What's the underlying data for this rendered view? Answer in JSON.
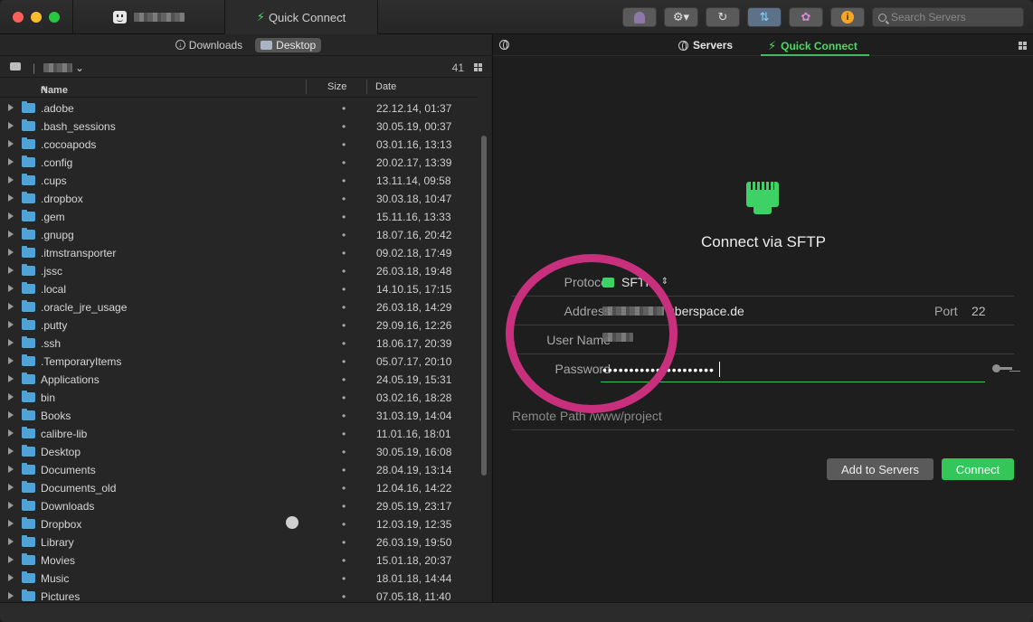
{
  "titlebar": {
    "tab_blurred_title": "",
    "tab_quick_connect": "Quick Connect",
    "search_placeholder": "Search Servers",
    "info_glyph": "i",
    "icons": [
      "ghost-icon",
      "gear-icon",
      "refresh-icon",
      "transfer-icon",
      "flower-icon",
      "info-icon",
      "search-icon"
    ]
  },
  "left_pane": {
    "locations": [
      "Downloads",
      "Desktop"
    ],
    "active_location": "Desktop",
    "path_separator": "|",
    "item_count": "41",
    "columns": {
      "name": "Name",
      "size": "Size",
      "date": "Date",
      "sort_arrow": "^"
    },
    "rows": [
      {
        "name": ".adobe",
        "size": "•",
        "date": "22.12.14, 01:37"
      },
      {
        "name": ".bash_sessions",
        "size": "•",
        "date": "30.05.19, 00:37"
      },
      {
        "name": ".cocoapods",
        "size": "•",
        "date": "03.01.16, 13:13"
      },
      {
        "name": ".config",
        "size": "•",
        "date": "20.02.17, 13:39"
      },
      {
        "name": ".cups",
        "size": "•",
        "date": "13.11.14, 09:58"
      },
      {
        "name": ".dropbox",
        "size": "•",
        "date": "30.03.18, 10:47"
      },
      {
        "name": ".gem",
        "size": "•",
        "date": "15.11.16, 13:33"
      },
      {
        "name": ".gnupg",
        "size": "•",
        "date": "18.07.16, 20:42"
      },
      {
        "name": ".itmstransporter",
        "size": "•",
        "date": "09.02.18, 17:49"
      },
      {
        "name": ".jssc",
        "size": "•",
        "date": "26.03.18, 19:48"
      },
      {
        "name": ".local",
        "size": "•",
        "date": "14.10.15, 17:15"
      },
      {
        "name": ".oracle_jre_usage",
        "size": "•",
        "date": "26.03.18, 14:29"
      },
      {
        "name": ".putty",
        "size": "•",
        "date": "29.09.16, 12:26"
      },
      {
        "name": ".ssh",
        "size": "•",
        "date": "18.06.17, 20:39"
      },
      {
        "name": ".TemporaryItems",
        "size": "•",
        "date": "05.07.17, 20:10"
      },
      {
        "name": "Applications",
        "size": "•",
        "date": "24.05.19, 15:31"
      },
      {
        "name": "bin",
        "size": "•",
        "date": "03.02.16, 18:28"
      },
      {
        "name": "Books",
        "size": "•",
        "date": "31.03.19, 14:04"
      },
      {
        "name": "calibre-lib",
        "size": "•",
        "date": "11.01.16, 18:01"
      },
      {
        "name": "Desktop",
        "size": "•",
        "date": "30.05.19, 16:08"
      },
      {
        "name": "Documents",
        "size": "•",
        "date": "28.04.19, 13:14"
      },
      {
        "name": "Documents_old",
        "size": "•",
        "date": "12.04.16, 14:22"
      },
      {
        "name": "Downloads",
        "size": "•",
        "date": "29.05.19, 23:17"
      },
      {
        "name": "Dropbox",
        "size": "•",
        "date": "12.03.19, 12:35"
      },
      {
        "name": "Library",
        "size": "•",
        "date": "26.03.19, 19:50"
      },
      {
        "name": "Movies",
        "size": "•",
        "date": "15.01.18, 20:37"
      },
      {
        "name": "Music",
        "size": "•",
        "date": "18.01.18, 14:44"
      },
      {
        "name": "Pictures",
        "size": "•",
        "date": "07.05.18, 11:40"
      }
    ]
  },
  "right_pane": {
    "tabs": {
      "servers": "Servers",
      "quick_connect": "Quick Connect"
    },
    "title": "Connect via SFTP",
    "form": {
      "protocol_label": "Protocol",
      "protocol_value": "SFTP",
      "address_label": "Address",
      "address_value": "uberspace.de",
      "port_label": "Port",
      "port_value": "22",
      "username_label": "User Name",
      "password_label": "Password",
      "password_value": "•••••••••••••••••••••",
      "remote_path_label": "Remote Path",
      "remote_path_value": "/www/project"
    },
    "buttons": {
      "add": "Add to Servers",
      "connect": "Connect"
    }
  },
  "colors": {
    "accent_green": "#3fbf5a",
    "highlight_ring": "#c8307e",
    "folder_blue": "#4fa3d6"
  }
}
